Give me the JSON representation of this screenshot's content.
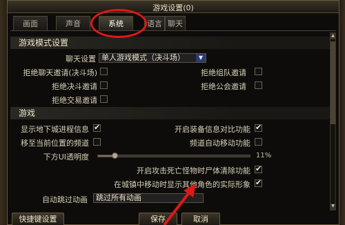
{
  "window": {
    "title": "游戏设置(0)"
  },
  "tabs": [
    {
      "label": "画面",
      "active": false
    },
    {
      "label": "声音",
      "active": false
    },
    {
      "label": "系统",
      "active": true
    },
    {
      "label": "语言",
      "active": false
    },
    {
      "label": "聊天",
      "active": false
    }
  ],
  "section_mode": {
    "title": "游戏模式设置",
    "chat_setting_label": "聊天设置",
    "chat_setting_value": "单人游戏模式（决斗场）",
    "options": [
      {
        "label": "拒绝聊天邀请(决斗场)",
        "checked": false
      },
      {
        "label": "拒绝组队邀请",
        "checked": false
      },
      {
        "label": "拒绝决斗邀请",
        "checked": false
      },
      {
        "label": "拒绝公会邀请",
        "checked": false
      },
      {
        "label": "拒绝交易邀请",
        "checked": false
      }
    ]
  },
  "section_game": {
    "title": "游戏",
    "options": [
      {
        "label": "显示地下城进程信息",
        "checked": true
      },
      {
        "label": "开启装备信息对比功能",
        "checked": true
      },
      {
        "label": "移至当前位置的频道",
        "checked": false
      },
      {
        "label": "频道自动移动功能",
        "checked": false
      }
    ],
    "ui_alpha_label": "下方UI透明度",
    "ui_alpha_value": "11%",
    "ui_alpha_level": 0.11,
    "wide_options": [
      {
        "label": "开启攻击死亡怪物时尸体清除功能",
        "checked": true
      },
      {
        "label": "在城镇中移动时显示其他角色的实际形象",
        "checked": true
      }
    ],
    "skip_anim_label": "自动跳过动画",
    "skip_anim_value": "跳过所有动画"
  },
  "footer": {
    "shortcut_label": "快捷键设置",
    "save_label": "保存",
    "cancel_label": "取消"
  },
  "annotation_color": "#e01818"
}
